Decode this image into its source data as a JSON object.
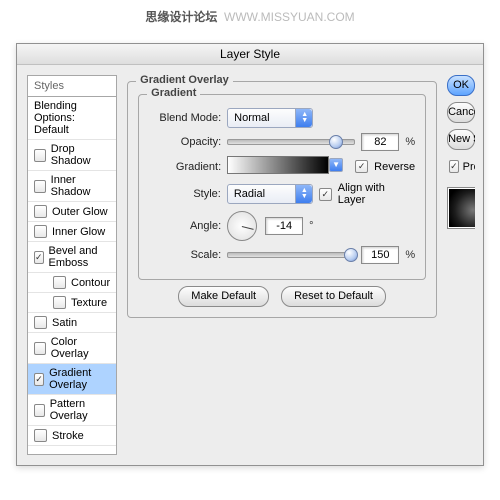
{
  "watermark": {
    "a": "思缘设计论坛",
    "b": "WWW.MISSYUAN.COM"
  },
  "title": "Layer Style",
  "styles_header": "Styles",
  "blending_row": "Blending Options: Default",
  "style_items": [
    {
      "label": "Drop Shadow",
      "checked": false,
      "sel": false,
      "indent": false
    },
    {
      "label": "Inner Shadow",
      "checked": false,
      "sel": false,
      "indent": false
    },
    {
      "label": "Outer Glow",
      "checked": false,
      "sel": false,
      "indent": false
    },
    {
      "label": "Inner Glow",
      "checked": false,
      "sel": false,
      "indent": false
    },
    {
      "label": "Bevel and Emboss",
      "checked": true,
      "sel": false,
      "indent": false
    },
    {
      "label": "Contour",
      "checked": false,
      "sel": false,
      "indent": true
    },
    {
      "label": "Texture",
      "checked": false,
      "sel": false,
      "indent": true
    },
    {
      "label": "Satin",
      "checked": false,
      "sel": false,
      "indent": false
    },
    {
      "label": "Color Overlay",
      "checked": false,
      "sel": false,
      "indent": false
    },
    {
      "label": "Gradient Overlay",
      "checked": true,
      "sel": true,
      "indent": false
    },
    {
      "label": "Pattern Overlay",
      "checked": false,
      "sel": false,
      "indent": false
    },
    {
      "label": "Stroke",
      "checked": false,
      "sel": false,
      "indent": false
    }
  ],
  "mid": {
    "group1": "Gradient Overlay",
    "group2": "Gradient",
    "blend_lbl": "Blend Mode:",
    "blend_val": "Normal",
    "opacity_lbl": "Opacity:",
    "opacity_val": "82",
    "pct": "%",
    "grad_lbl": "Gradient:",
    "reverse": "Reverse",
    "style_lbl": "Style:",
    "style_val": "Radial",
    "align": "Align with Layer",
    "angle_lbl": "Angle:",
    "angle_val": "-14",
    "deg": "°",
    "scale_lbl": "Scale:",
    "scale_val": "150",
    "b1": "Make Default",
    "b2": "Reset to Default"
  },
  "right": {
    "ok": "OK",
    "cancel": "Cancel",
    "newstyle": "New Style..",
    "preview": "Preview"
  }
}
